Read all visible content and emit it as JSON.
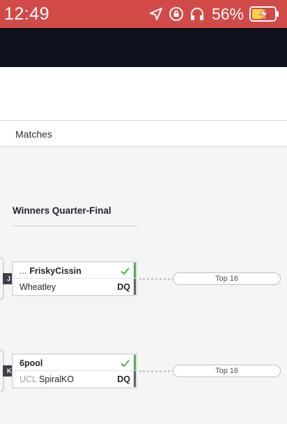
{
  "status_bar": {
    "time": "12:49",
    "battery_percent": "56%",
    "icons": [
      "location-arrow-icon",
      "rotation-lock-icon",
      "headphones-icon",
      "battery-charging-icon"
    ],
    "bg_color": "#d24a47"
  },
  "header": {
    "bg_color": "#0c111b"
  },
  "tabs": {
    "matches_label": "Matches"
  },
  "round": {
    "title": "Winners Quarter-Final"
  },
  "matches": [
    {
      "id": "J",
      "players": [
        {
          "ellipsis": "...",
          "prefix": "",
          "name": "FriskyCissin",
          "bold": true,
          "result": "",
          "won": true
        },
        {
          "ellipsis": "",
          "prefix": "",
          "name": "Wheatley",
          "bold": false,
          "result": "DQ",
          "won": false
        }
      ],
      "next": "Top 16"
    },
    {
      "id": "K",
      "players": [
        {
          "ellipsis": "",
          "prefix": "",
          "name": "6pool",
          "bold": true,
          "result": "",
          "won": true
        },
        {
          "ellipsis": "",
          "prefix": "UCL",
          "name": "SpiralKO",
          "bold": false,
          "result": "DQ",
          "won": false
        }
      ],
      "next": "Top 16"
    }
  ],
  "colors": {
    "win": "#4caf50",
    "lose": "#5b5f68"
  }
}
